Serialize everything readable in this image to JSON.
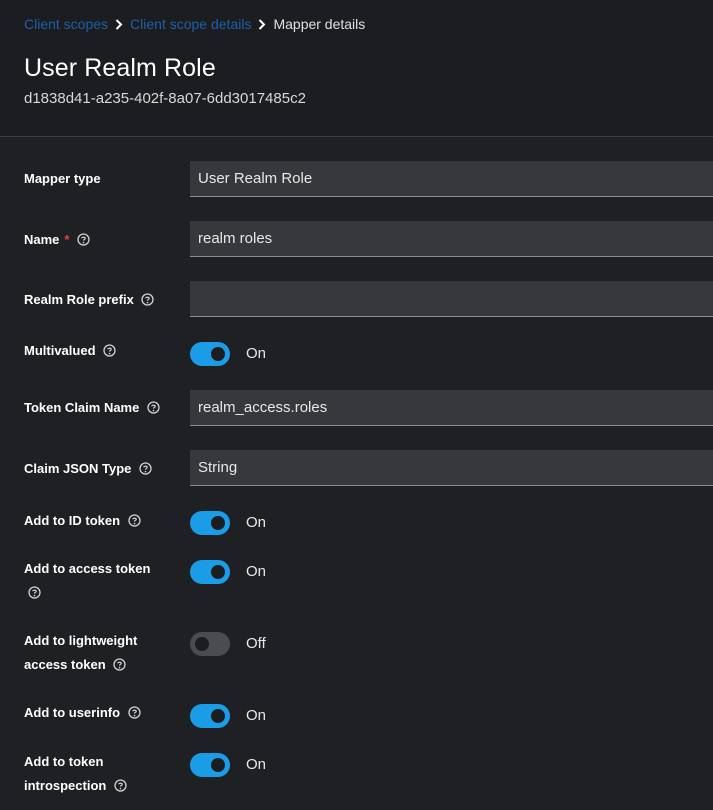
{
  "breadcrumb": {
    "items": [
      "Client scopes",
      "Client scope details"
    ],
    "current": "Mapper details"
  },
  "header": {
    "title": "User Realm Role",
    "subtitle": "d1838d41-a235-402f-8a07-6dd3017485c2"
  },
  "form": {
    "mapper_type": {
      "label": "Mapper type",
      "value": "User Realm Role"
    },
    "name": {
      "label": "Name",
      "required_mark": "*",
      "value": "realm roles"
    },
    "realm_role_prefix": {
      "label": "Realm Role prefix",
      "value": ""
    },
    "multivalued": {
      "label": "Multivalued",
      "state": "On"
    },
    "token_claim_name": {
      "label": "Token Claim Name",
      "value": "realm_access.roles"
    },
    "claim_json_type": {
      "label": "Claim JSON Type",
      "value": "String"
    },
    "add_to_id_token": {
      "label": "Add to ID token",
      "state": "On"
    },
    "add_to_access_token": {
      "label_line1": "Add to access token",
      "state": "On"
    },
    "add_to_lightweight_access_token": {
      "label_line1": "Add to lightweight",
      "label_line2": "access token",
      "state": "Off"
    },
    "add_to_userinfo": {
      "label": "Add to userinfo",
      "state": "On"
    },
    "add_to_token_introspection": {
      "label_line1": "Add to token",
      "label_line2": "introspection",
      "state": "On"
    }
  },
  "colors": {
    "toggle_on": "#1b9ce6",
    "toggle_off": "#4a4c50",
    "link": "#1f5fa8",
    "required": "#dd4444"
  }
}
